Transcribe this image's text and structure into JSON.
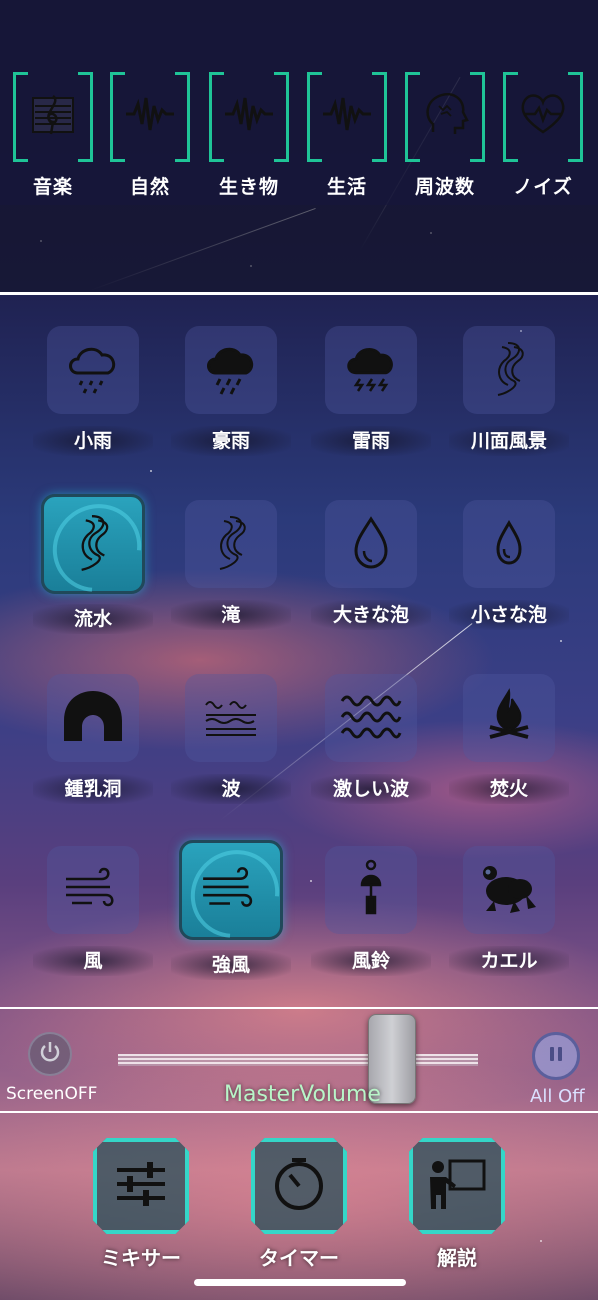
{
  "categories": [
    {
      "label": "音楽",
      "icon": "music-score-icon"
    },
    {
      "label": "自然",
      "icon": "waveform-icon"
    },
    {
      "label": "生き物",
      "icon": "waveform-icon"
    },
    {
      "label": "生活",
      "icon": "waveform-icon"
    },
    {
      "label": "周波数",
      "icon": "brain-head-icon"
    },
    {
      "label": "ノイズ",
      "icon": "heartbeat-icon"
    }
  ],
  "sounds": [
    {
      "label": "小雨",
      "icon": "light-rain-icon",
      "active": false
    },
    {
      "label": "豪雨",
      "icon": "heavy-rain-icon",
      "active": false
    },
    {
      "label": "雷雨",
      "icon": "thunderstorm-icon",
      "active": false
    },
    {
      "label": "川面風景",
      "icon": "river-icon",
      "active": false
    },
    {
      "label": "流水",
      "icon": "river-icon",
      "active": true
    },
    {
      "label": "滝",
      "icon": "waterfall-icon",
      "active": false
    },
    {
      "label": "大きな泡",
      "icon": "droplet-icon",
      "active": false
    },
    {
      "label": "小さな泡",
      "icon": "droplet-icon",
      "active": false
    },
    {
      "label": "鍾乳洞",
      "icon": "cave-icon",
      "active": false
    },
    {
      "label": "波",
      "icon": "waves-icon",
      "active": false
    },
    {
      "label": "激しい波",
      "icon": "rough-waves-icon",
      "active": false
    },
    {
      "label": "焚火",
      "icon": "campfire-icon",
      "active": false
    },
    {
      "label": "風",
      "icon": "wind-icon",
      "active": false
    },
    {
      "label": "強風",
      "icon": "wind-icon",
      "active": true
    },
    {
      "label": "風鈴",
      "icon": "wind-chime-icon",
      "active": false
    },
    {
      "label": "カエル",
      "icon": "frog-icon",
      "active": false
    }
  ],
  "volume": {
    "screen_off_label": "ScreenOFF",
    "master_label": "MasterVolume",
    "all_off_label": "All Off",
    "master_level": 0.76
  },
  "tools": [
    {
      "label": "ミキサー",
      "icon": "mixer-sliders-icon"
    },
    {
      "label": "タイマー",
      "icon": "timer-icon"
    },
    {
      "label": "解説",
      "icon": "presentation-icon"
    }
  ],
  "colors": {
    "accent_green": "#1fc497",
    "accent_cyan": "#35d6c8",
    "active_tile": "#2aa3bd"
  }
}
